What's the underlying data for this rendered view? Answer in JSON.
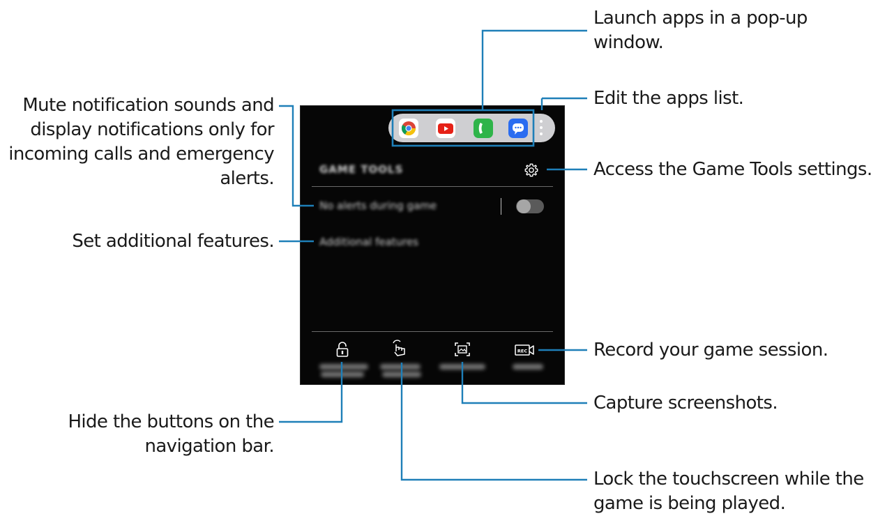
{
  "callouts": {
    "popup_apps": [
      "Launch apps in a pop-up",
      "window."
    ],
    "edit_apps": [
      "Edit the apps list."
    ],
    "settings": [
      "Access the Game Tools settings."
    ],
    "record": [
      "Record your game session."
    ],
    "screenshot": [
      "Capture screenshots."
    ],
    "lock_touch": [
      "Lock the touchscreen while the",
      "game is being played."
    ],
    "mute": [
      "Mute notification sounds and",
      "display notifications only for",
      "incoming calls and emergency",
      "alerts."
    ],
    "additional": [
      "Set additional features."
    ],
    "hide_nav": [
      "Hide the buttons on the",
      "navigation bar."
    ]
  },
  "panel": {
    "header": "GAME TOOLS",
    "no_alerts": "No alerts during game",
    "additional_features": "Additional features"
  },
  "app_icons": [
    "chrome-icon",
    "youtube-icon",
    "phone-icon",
    "messages-icon",
    "more-options-icon"
  ],
  "tool_icons": [
    "navigation-lock-icon",
    "touch-lock-icon",
    "screenshot-icon",
    "record-icon"
  ],
  "colors": {
    "leader": "#1e7fb8",
    "panel_bg": "#060606",
    "apps_bar": "#cfcfd2",
    "text": "#1a1a1a"
  }
}
